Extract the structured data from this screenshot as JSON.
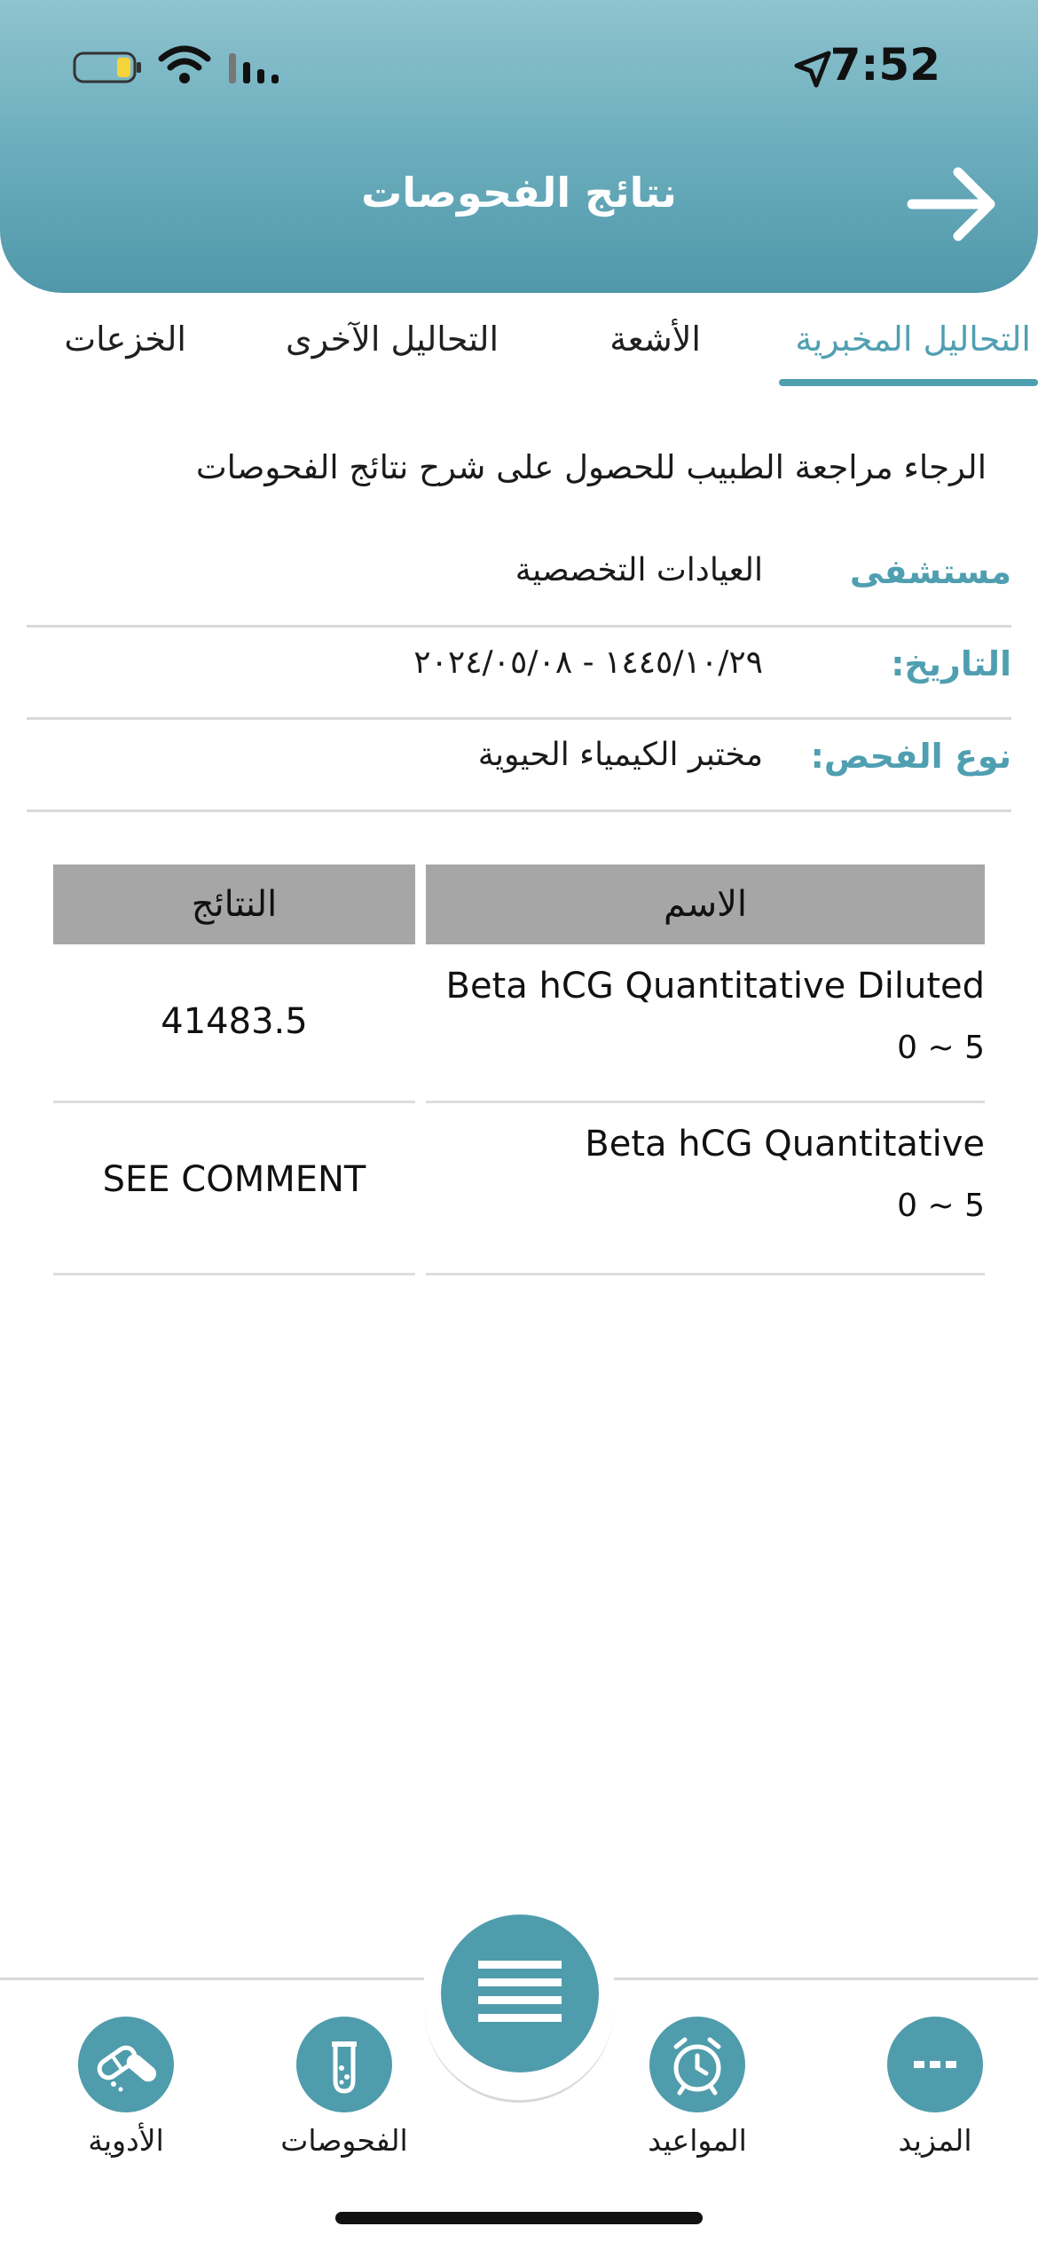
{
  "status_bar": {
    "time": "7:52"
  },
  "header": {
    "title": "نتائج الفحوصات"
  },
  "tabs": [
    {
      "label": "التحاليل المخبرية",
      "active": true
    },
    {
      "label": "الأشعة",
      "active": false
    },
    {
      "label": "التحاليل الآخرى",
      "active": false
    },
    {
      "label": "الخزعات",
      "active": false
    }
  ],
  "notice": "الرجاء مراجعة الطبيب للحصول على شرح نتائج الفحوصات",
  "info": {
    "hospital_label": "مستشفى",
    "hospital_value": "العيادات التخصصية",
    "date_label": "التاريخ:",
    "date_value": "١٤٤٥/١٠/٢٩ - ٢٠٢٤/٠٥/٠٨",
    "type_label": "نوع الفحص:",
    "type_value": "مختبر الكيمياء الحيوية"
  },
  "table": {
    "headers": {
      "name": "الاسم",
      "result": "النتائج"
    },
    "rows": [
      {
        "name": "Beta hCG Quantitative Diluted",
        "range": "0 ~ 5",
        "result": "41483.5"
      },
      {
        "name": "Beta hCG Quantitative",
        "range": "0 ~ 5",
        "result": "SEE COMMENT"
      }
    ]
  },
  "bottom_nav": {
    "items": [
      {
        "label": "المزيد",
        "icon": "more-dots-icon"
      },
      {
        "label": "المواعيد",
        "icon": "alarm-clock-icon"
      },
      {
        "label": "الفحوصات",
        "icon": "test-tube-icon"
      },
      {
        "label": "الأدوية",
        "icon": "pills-icon"
      }
    ],
    "center_icon": "menu-lines-icon"
  },
  "colors": {
    "accent": "#4f9fb1",
    "header_gradient_top": "#8fc3ce",
    "table_header": "#a6a6a6"
  }
}
